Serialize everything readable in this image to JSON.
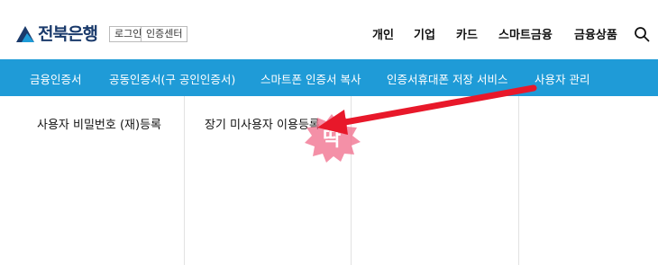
{
  "header": {
    "logo_text": "전북은행",
    "util_login": "로그인",
    "util_cert_center": "인증센터",
    "gnb": [
      "개인",
      "기업",
      "카드",
      "스마트금융",
      "금융상품"
    ]
  },
  "navbar": {
    "items": [
      "금융인증서",
      "공동인증서(구 공인인증서)",
      "스마트폰 인증서 복사",
      "인증서휴대폰 저장 서비스",
      "사용자 관리"
    ]
  },
  "submenu": {
    "items": [
      "사용자 비밀번호 (재)등록",
      "장기 미사용자 이용등록"
    ]
  },
  "annotation": {
    "click_label": "딱",
    "arrow_color": "#e8182a",
    "burst_color": "#f06b8a"
  },
  "colors": {
    "nav_bg": "#1f9bd7",
    "brand": "#1a3a6b"
  }
}
